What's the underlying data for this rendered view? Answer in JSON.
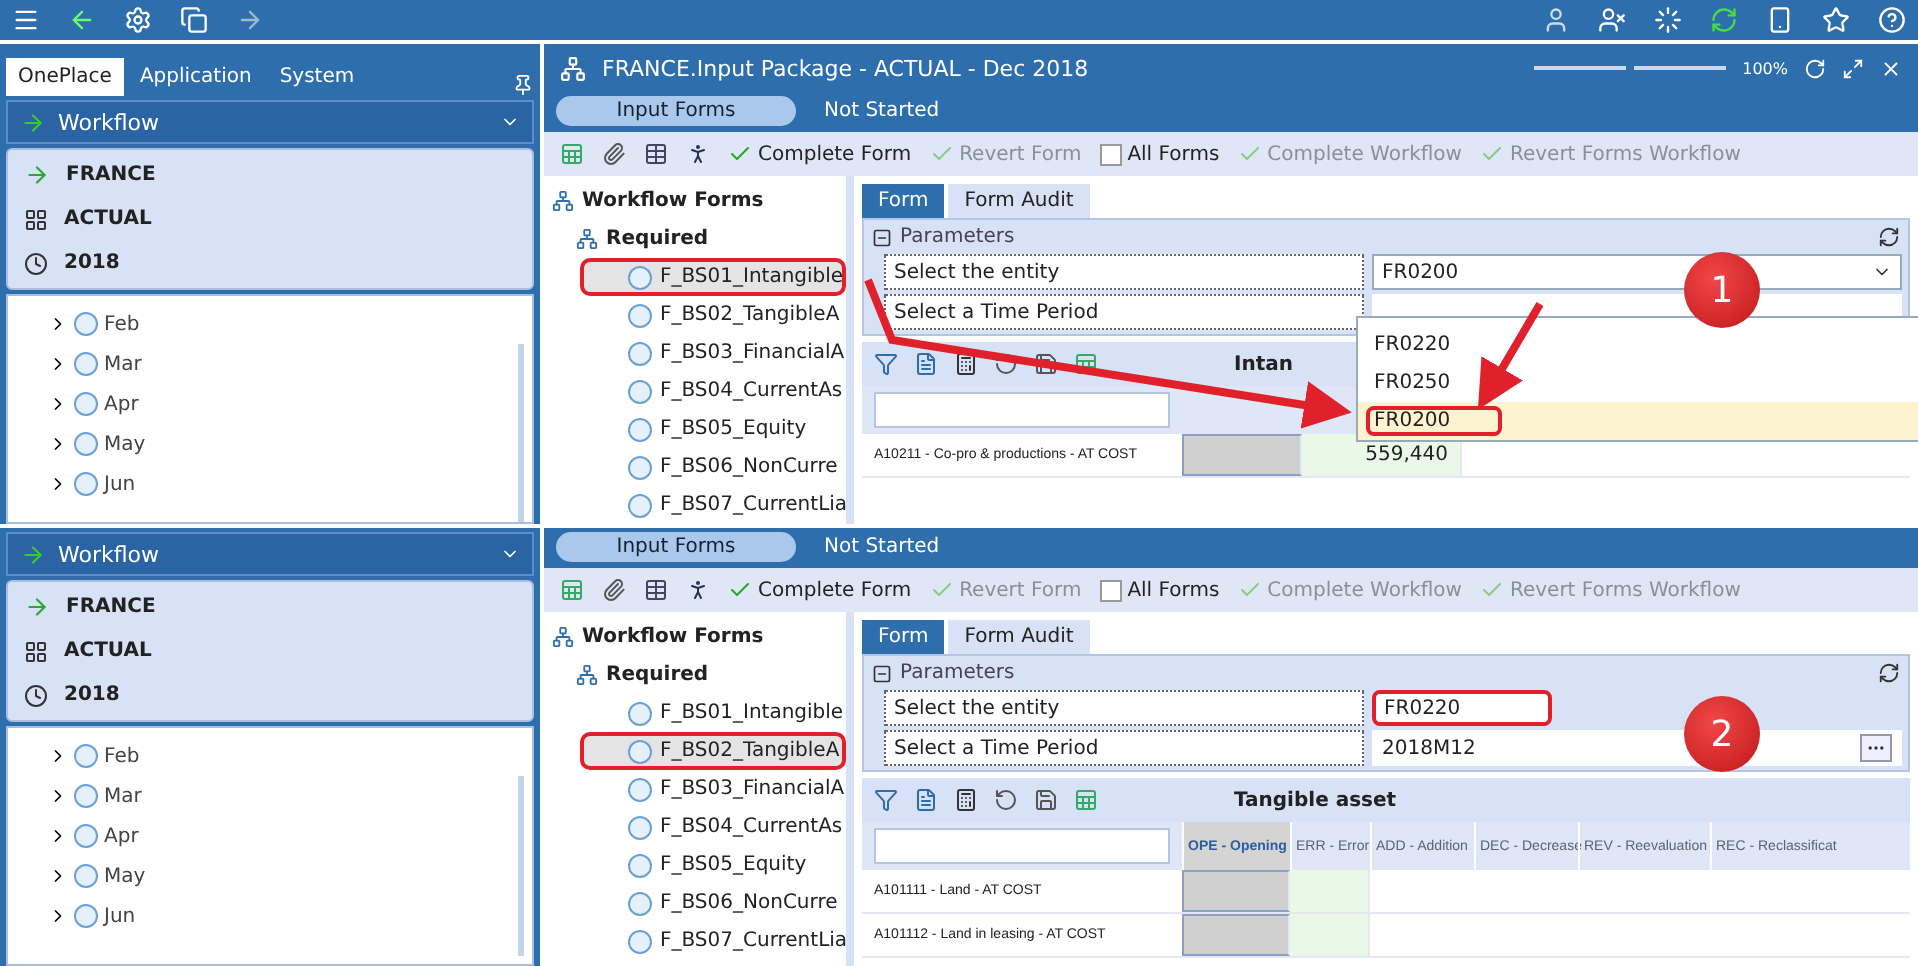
{
  "shots": [
    {
      "left": {
        "tabs": [
          {
            "label": "OnePlace",
            "selected": true
          },
          {
            "label": "Application",
            "selected": false
          },
          {
            "label": "System",
            "selected": false
          }
        ],
        "workflow": "Workflow",
        "context": [
          {
            "kind": "entity",
            "label": "FRANCE"
          },
          {
            "kind": "scenario",
            "label": "ACTUAL"
          },
          {
            "kind": "time",
            "label": "2018"
          }
        ],
        "months": [
          "Feb",
          "Mar",
          "Apr",
          "May",
          "Jun"
        ]
      },
      "right": {
        "title": "FRANCE.Input Package  -  ACTUAL  -  Dec 2018",
        "zoom_slider": {
          "level": 0.5
        },
        "zoom": "100%",
        "status": {
          "button": "Input Forms",
          "text": "Not Started"
        },
        "toolbar": [
          {
            "label": "Complete Form",
            "kind": "action",
            "disabled": false
          },
          {
            "label": "Revert Form",
            "kind": "revert",
            "disabled": true
          },
          {
            "label": "All Forms",
            "kind": "checkbox",
            "checked": false
          },
          {
            "label": "Complete Workflow",
            "kind": "action",
            "disabled": true
          },
          {
            "label": "Revert Forms Workflow",
            "kind": "revert",
            "disabled": true
          }
        ],
        "tree": {
          "label": "Workflow Forms",
          "children": [
            {
              "label": "Required",
              "children": [
                {
                  "label": "F_BS01_Intangible",
                  "selected": true
                },
                {
                  "label": "F_BS02_TangibleA",
                  "selected": false
                },
                {
                  "label": "F_BS03_FinancialA",
                  "selected": false
                },
                {
                  "label": "F_BS04_CurrentAs",
                  "selected": false
                },
                {
                  "label": "F_BS05_Equity",
                  "selected": false
                },
                {
                  "label": "F_BS06_NonCurre",
                  "selected": false
                },
                {
                  "label": "F_BS07_CurrentLia",
                  "selected": false
                }
              ]
            }
          ]
        },
        "form_tabs": [
          {
            "label": "Form",
            "selected": true
          },
          {
            "label": "Form Audit",
            "selected": false
          }
        ],
        "parameters": {
          "title": "Parameters",
          "rows": [
            {
              "label": "Select the entity",
              "value": "FR0200",
              "kind": "dropdown",
              "highlighted": false
            },
            {
              "label": "Select a Time Period",
              "kind": "covered",
              "highlighted": false
            }
          ]
        },
        "dropdown": {
          "options": [
            {
              "label": "FR0220",
              "selected": false
            },
            {
              "label": "FR0250",
              "selected": false
            },
            {
              "label": "FR0200",
              "selected": true
            }
          ]
        },
        "grid": {
          "title": "Intan",
          "rows": [
            {
              "label": "A10211 - Co-pro & productions - AT COST",
              "cells": [
                "",
                "559,440"
              ]
            }
          ]
        },
        "callout": "1"
      }
    },
    {
      "left": {
        "workflow": "Workflow",
        "context": [
          {
            "kind": "entity",
            "label": "FRANCE"
          },
          {
            "kind": "scenario",
            "label": "ACTUAL"
          },
          {
            "kind": "time",
            "label": "2018"
          }
        ],
        "months": [
          "Feb",
          "Mar",
          "Apr",
          "May",
          "Jun"
        ]
      },
      "right": {
        "status": {
          "button": "Input Forms",
          "text": "Not Started"
        },
        "toolbar": [
          {
            "label": "Complete Form",
            "kind": "action",
            "disabled": false
          },
          {
            "label": "Revert Form",
            "kind": "revert",
            "disabled": true
          },
          {
            "label": "All Forms",
            "kind": "checkbox",
            "checked": false
          },
          {
            "label": "Complete Workflow",
            "kind": "action",
            "disabled": true
          },
          {
            "label": "Revert Forms Workflow",
            "kind": "revert",
            "disabled": true
          }
        ],
        "tree": {
          "label": "Workflow Forms",
          "children": [
            {
              "label": "Required",
              "children": [
                {
                  "label": "F_BS01_Intangible",
                  "selected": false
                },
                {
                  "label": "F_BS02_TangibleA",
                  "selected": true
                },
                {
                  "label": "F_BS03_FinancialA",
                  "selected": false
                },
                {
                  "label": "F_BS04_CurrentAs",
                  "selected": false
                },
                {
                  "label": "F_BS05_Equity",
                  "selected": false
                },
                {
                  "label": "F_BS06_NonCurre",
                  "selected": false
                },
                {
                  "label": "F_BS07_CurrentLia",
                  "selected": false
                }
              ]
            }
          ]
        },
        "form_tabs": [
          {
            "label": "Form",
            "selected": true
          },
          {
            "label": "Form Audit",
            "selected": false
          }
        ],
        "parameters": {
          "title": "Parameters",
          "rows": [
            {
              "label": "Select the entity",
              "value": "FR0220",
              "kind": "text",
              "highlighted": true
            },
            {
              "label": "Select a Time Period",
              "value": "2018M12",
              "kind": "picker",
              "highlighted": false
            }
          ]
        },
        "grid": {
          "title": "Tangible asset",
          "columns": [
            "OPE - Opening",
            "ERR - Error",
            "ADD - Addition",
            "DEC - Decrease",
            "REV - Reevaluation",
            "REC - Reclassificat"
          ],
          "rows": [
            {
              "label": "A101111 - Land - AT COST",
              "cells": [
                "",
                ""
              ]
            },
            {
              "label": "A101112 - Land in leasing - AT COST",
              "cells": [
                "",
                ""
              ]
            }
          ]
        },
        "callout": "2"
      }
    }
  ]
}
